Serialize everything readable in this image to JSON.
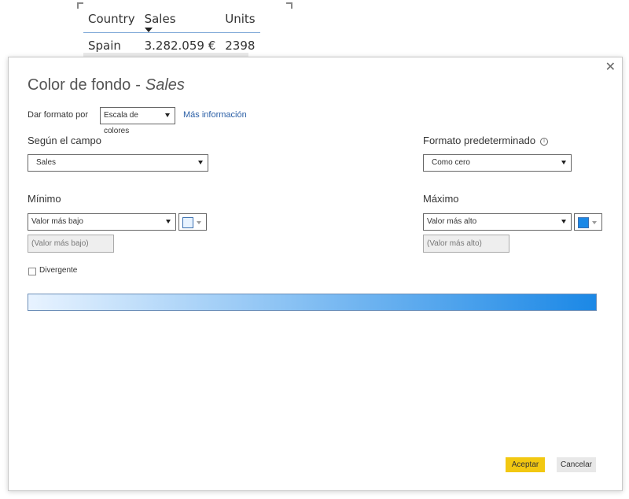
{
  "visual_table": {
    "headers": [
      "Country",
      "Sales",
      "Units"
    ],
    "rows": [
      [
        "Spain",
        "3.282.059 €",
        "2398"
      ]
    ]
  },
  "dialog": {
    "title_prefix": "Color de fondo",
    "title_separator": "-",
    "title_field": "Sales",
    "close_glyph": "✕",
    "format_by_label": "Dar formato por",
    "format_by_value": "Escala de colores",
    "more_info_link": "Más información",
    "based_on_field_label": "Según el campo",
    "based_on_field_value": "Sales",
    "default_format_label": "Formato predeterminado",
    "default_format_value": "Como cero",
    "minimum": {
      "label": "Mínimo",
      "select_value": "Valor más bajo",
      "input_placeholder": "(Valor más bajo)",
      "color": "#e8f3ff"
    },
    "maximum": {
      "label": "Máximo",
      "select_value": "Valor más alto",
      "input_placeholder": "(Valor más alto)",
      "color": "#1b88e6"
    },
    "diverging_label": "Divergente",
    "gradient_from": "#e8f3ff",
    "gradient_to": "#1b88e6",
    "ok_button": "Aceptar",
    "cancel_button": "Cancelar"
  },
  "colors": {
    "accent": "#f2c811",
    "link": "#2b5fa6"
  }
}
